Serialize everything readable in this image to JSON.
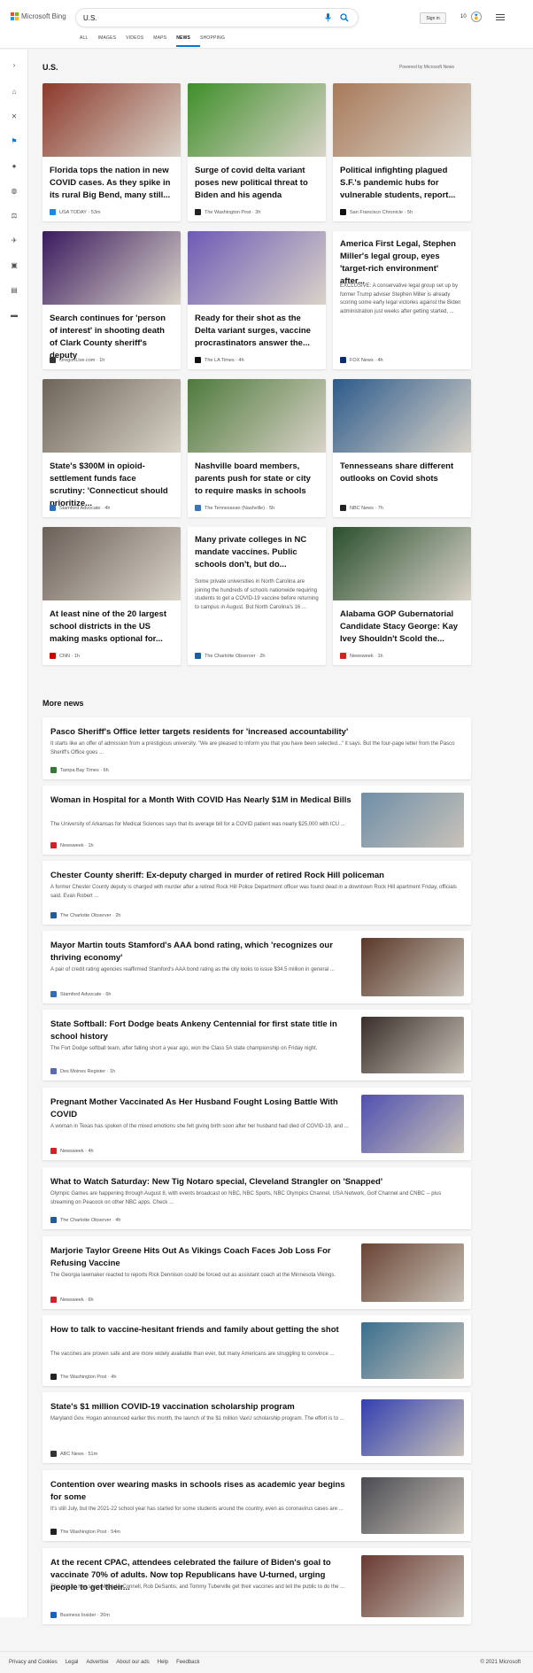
{
  "header": {
    "logo_text": "Microsoft Bing",
    "search_value": "U.S.",
    "tabs": [
      "ALL",
      "IMAGES",
      "VIDEOS",
      "MAPS",
      "NEWS",
      "SHOPPING"
    ],
    "active_tab": "NEWS",
    "signin_label": "Sign in",
    "points": "10"
  },
  "section": {
    "title": "U.S.",
    "powered_by": "Powered by Microsoft News"
  },
  "cards": [
    {
      "title": "Florida tops the nation in new COVID cases. As they spike in its rural Big Bend, many still...",
      "snippet": "",
      "source": "USA TODAY",
      "age": "53m",
      "favicon_color": "#1e88e5",
      "img": "#8c3a2c"
    },
    {
      "title": "Surge of covid delta variant poses new political threat to Biden and his agenda",
      "snippet": "",
      "source": "The Washington Post",
      "age": "3h",
      "favicon_color": "#222222",
      "img": "#3f8f2a"
    },
    {
      "title": "Political infighting plagued S.F.'s pandemic hubs for vulnerable students, report...",
      "snippet": "",
      "source": "San Francisco Chronicle",
      "age": "5h",
      "favicon_color": "#111111",
      "img": "#a87a5a"
    },
    {
      "title": "Search continues for 'person of interest' in shooting death of Clark County sheriff's deputy",
      "snippet": "",
      "source": "OregonLive.com",
      "age": "1h",
      "favicon_color": "#333333",
      "img": "#3a1a5e"
    },
    {
      "title": "Ready for their shot as the Delta variant surges, vaccine procrastinators answer the...",
      "snippet": "",
      "source": "The LA Times",
      "age": "4h",
      "favicon_color": "#111111",
      "img": "#6d5bb5"
    },
    {
      "title": "America First Legal, Stephen Miller's legal group, eyes 'target-rich environment' after...",
      "snippet": "EXCLUSIVE: A conservative legal group set up by former Trump adviser Stephen Miller is already scoring some early legal victories against the Biden administration just weeks after getting started, ...",
      "source": "FOX News",
      "age": "4h",
      "favicon_color": "#0d2c6b",
      "img": ""
    },
    {
      "title": "State's $300M in opioid-settlement funds face scrutiny: 'Connecticut should prioritize...",
      "snippet": "",
      "source": "Stamford Advocate",
      "age": "4h",
      "favicon_color": "#2f6fb5",
      "img": "#6e6458"
    },
    {
      "title": "Nashville board members, parents push for state or city to require masks in schools",
      "snippet": "",
      "source": "The Tennessean (Nashville)",
      "age": "5h",
      "favicon_color": "#3b73b9",
      "img": "#4f7a3c"
    },
    {
      "title": "Tennesseans share different outlooks on Covid shots",
      "snippet": "",
      "source": "NBC News",
      "age": "7h",
      "favicon_color": "#222222",
      "img": "#2c5a8a"
    },
    {
      "title": "At least nine of the 20 largest school districts in the US making masks optional for...",
      "snippet": "",
      "source": "CNN",
      "age": "1h",
      "favicon_color": "#cc0000",
      "img": "#6b5f58"
    },
    {
      "title": "Many private colleges in NC mandate vaccines. Public schools don't, but do...",
      "snippet": "Some private universities in North Carolina are joining the hundreds of schools nationwide requiring students to get a COVID-19 vaccine before returning to campus in August. But North Carolina's 16 ...",
      "source": "The Charlotte Observer",
      "age": "2h",
      "favicon_color": "#1f5e9c",
      "img": ""
    },
    {
      "title": "Alabama GOP Gubernatorial Candidate Stacy George: Kay Ivey Shouldn't Scold the...",
      "snippet": "",
      "source": "Newsweek",
      "age": "1h",
      "favicon_color": "#d81f26",
      "img": "#2a4f2e"
    }
  ],
  "more": {
    "title": "More news",
    "rows": [
      {
        "title": "Pasco Sheriff's Office letter targets residents for 'increased accountability'",
        "snippet": "It starts like an offer of admission from a prestigious university. \"We are pleased to inform you that you have been selected...\" it says. But the four-page letter from the Pasco Sheriff's Office goes ...",
        "source": "Tampa Bay Times",
        "age": "6h",
        "favicon_color": "#2e7d32",
        "img": ""
      },
      {
        "title": "Woman in Hospital for a Month With COVID Has Nearly $1M in Medical Bills",
        "snippet": "The University of Arkansas for Medical Sciences says that its average bill for a COVID patient was nearly $25,000 with ICU ...",
        "source": "Newsweek",
        "age": "1h",
        "favicon_color": "#d81f26",
        "img": "#6f8fa8"
      },
      {
        "title": "Chester County sheriff: Ex-deputy charged in murder of retired Rock Hill policeman",
        "snippet": "A former Chester County deputy is charged with murder after a retired Rock Hill Police Department officer was found dead in a downtown Rock Hill apartment Friday, officials said. Evan Robert ...",
        "source": "The Charlotte Observer",
        "age": "2h",
        "favicon_color": "#1f5e9c",
        "img": ""
      },
      {
        "title": "Mayor Martin touts Stamford's AAA bond rating, which 'recognizes our thriving economy'",
        "snippet": "A pair of credit rating agencies reaffirmed Stamford's AAA bond rating as the city looks to issue $34.5 million in general ...",
        "source": "Stamford Advocate",
        "age": "6h",
        "favicon_color": "#2f6fb5",
        "img": "#5a3828"
      },
      {
        "title": "State Softball: Fort Dodge beats Ankeny Centennial for first state title in school history",
        "snippet": "The Fort Dodge softball team, after falling short a year ago, won the Class 5A state championship on Friday night.",
        "source": "Des Moines Register",
        "age": "1h",
        "favicon_color": "#5a6ab5",
        "img": "#3a2e2a"
      },
      {
        "title": "Pregnant Mother Vaccinated As Her Husband Fought Losing Battle With COVID",
        "snippet": "A woman in Texas has spoken of the mixed emotions she felt giving birth soon after her husband had died of COVID-19, and ...",
        "source": "Newsweek",
        "age": "4h",
        "favicon_color": "#d81f26",
        "img": "#5050b0"
      },
      {
        "title": "What to Watch Saturday: New Tig Notaro special, Cleveland Strangler on 'Snapped'",
        "snippet": "Olympic Games are happening through August 8, with events broadcast on NBC, NBC Sports, NBC Olympics Channel, USA Network, Golf Channel and CNBC -- plus streaming on Peacock on other NBC apps. Check ...",
        "source": "The Charlotte Observer",
        "age": "4h",
        "favicon_color": "#1f5e9c",
        "img": ""
      },
      {
        "title": "Marjorie Taylor Greene Hits Out As Vikings Coach Faces Job Loss For Refusing Vaccine",
        "snippet": "The Georgia lawmaker reacted to reports Rick Dennison could be forced out as assistant coach at the Minnesota Vikings.",
        "source": "Newsweek",
        "age": "6h",
        "favicon_color": "#d81f26",
        "img": "#6a4434"
      },
      {
        "title": "How to talk to vaccine-hesitant friends and family about getting the shot",
        "snippet": "The vaccines are proven safe and are more widely available than ever, but many Americans are struggling to convince ...",
        "source": "The Washington Post",
        "age": "4h",
        "favicon_color": "#222222",
        "img": "#3a6f8f"
      },
      {
        "title": "State's $1 million COVID-19 vaccination scholarship program",
        "snippet": "Maryland Gov. Hogan announced earlier this month, the launch of the $1 million VaxU scholarship program. The effort is to ...",
        "source": "ABC News",
        "age": "51m",
        "favicon_color": "#333333",
        "img": "#3340b0"
      },
      {
        "title": "Contention over wearing masks in schools rises as academic year begins for some",
        "snippet": "It's still July, but the 2021-22 school year has started for some students around the country, even as coronavirus cases are ...",
        "source": "The Washington Post",
        "age": "54m",
        "favicon_color": "#222222",
        "img": "#4b4b52"
      },
      {
        "title": "At the recent CPAC, attendees celebrated the failure of Biden's goal to vaccinate 70% of adults. Now top Republicans have U-turned, urging people to get their...",
        "snippet": "This U-turn has seen Mitch McConnell, Rob DeSantis, and Tommy Tuberville get their vaccines and tell the public to do the ...",
        "source": "Business Insider",
        "age": "20m",
        "favicon_color": "#1565c0",
        "img": "#6a3a32"
      }
    ]
  },
  "footer": {
    "links": [
      "Privacy and Cookies",
      "Legal",
      "Advertise",
      "About our ads",
      "Help",
      "Feedback"
    ],
    "copyright": "© 2021 Microsoft"
  }
}
